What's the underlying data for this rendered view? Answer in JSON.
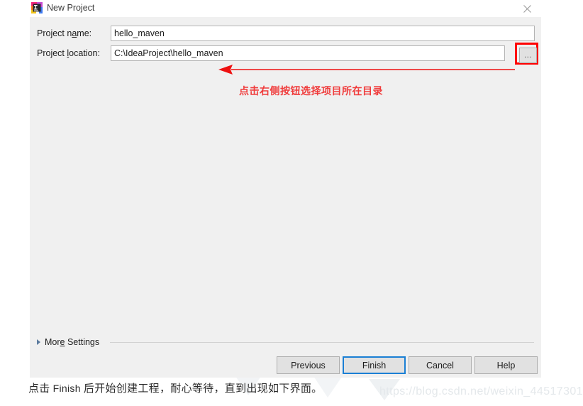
{
  "window": {
    "title": "New Project",
    "app_icon": "intellij-idea-icon",
    "close_label": "✕"
  },
  "form": {
    "fields": [
      {
        "label_before": "Project n",
        "label_mnemonic": "a",
        "label_after": "me:",
        "label_full": "Project name:",
        "value": "hello_maven",
        "placeholder": ""
      },
      {
        "label_before": "Project ",
        "label_mnemonic": "l",
        "label_after": "ocation:",
        "label_full": "Project location:",
        "value": "C:\\IdeaProject\\hello_maven",
        "placeholder": ""
      }
    ],
    "browse_button_label": "..."
  },
  "more_settings": {
    "label_before": "Mor",
    "label_mnemonic": "e",
    "label_after": " Settings",
    "label_full": "More Settings",
    "expanded": false
  },
  "buttons": [
    {
      "id": "previous",
      "label": "Previous",
      "default": false
    },
    {
      "id": "finish",
      "label": "Finish",
      "default": true
    },
    {
      "id": "cancel",
      "label": "Cancel",
      "default": false
    },
    {
      "id": "help",
      "label": "Help",
      "default": false
    }
  ],
  "annotations": {
    "arrow_text": "点击右侧按钮选择项目所在目录",
    "highlight_color": "#ff0000",
    "text_color": "#f03c3c"
  },
  "caption": {
    "part1": "点击 ",
    "latin": "Finish",
    "part2": " 后开始创建工程，耐心等待，直到出现如下界面。",
    "full": "点击 Finish 后开始创建工程，耐心等待，直到出现如下界面。"
  },
  "watermark": {
    "text": "https://blog.csdn.net/weixin_44517301"
  },
  "theme": {
    "dialog_bg": "#f0f0f0",
    "titlebar_bg": "#ffffff",
    "input_bg": "#ffffff",
    "input_border": "#b4b4b4",
    "button_bg": "#e1e1e1",
    "button_border": "#adadad",
    "default_button_border": "#1a7fd4",
    "text": "#1c1c1c"
  }
}
